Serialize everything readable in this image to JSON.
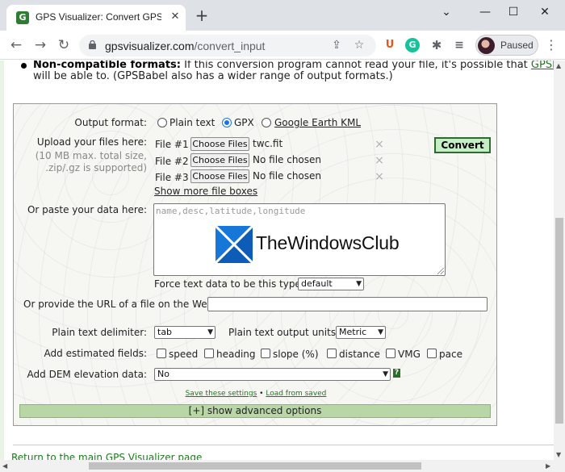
{
  "browser": {
    "tab_title": "GPS Visualizer: Convert GPS files",
    "url_host": "gpsvisualizer.com",
    "url_path": "/convert_input",
    "profile_status": "Paused"
  },
  "page": {
    "note_bold": "Non-compatible formats:",
    "note_text": "If this conversion program cannot read your file, it's possible that",
    "note_link": "GPSBabel",
    "note_line2": "will be able to. (GPSBabel also has a wider range of output formats.)",
    "form": {
      "output_format_label": "Output format:",
      "output_options": [
        "Plain text",
        "GPX",
        "Google Earth KML"
      ],
      "output_selected": "GPX",
      "upload_label": "Upload your files here:",
      "upload_sub1": "(10 MB max. total size,",
      "upload_sub2": ".zip/.gz is supported)",
      "files": [
        {
          "label": "File #1",
          "button": "Choose Files",
          "status": "twc.fit"
        },
        {
          "label": "File #2",
          "button": "Choose Files",
          "status": "No file chosen"
        },
        {
          "label": "File #3",
          "button": "Choose Files",
          "status": "No file chosen"
        }
      ],
      "show_more": "Show more file boxes",
      "convert_button": "Convert",
      "paste_label": "Or paste your data here:",
      "paste_placeholder": "name,desc,latitude,longitude",
      "watermark": "TheWindowsClub",
      "force_label": "Force text data to be this type:",
      "force_value": "default",
      "url_label": "Or provide the URL of a file on the Web:",
      "delimiter_label": "Plain text delimiter:",
      "delimiter_value": "tab",
      "units_label": "Plain text output units:",
      "units_value": "Metric",
      "estimated_label": "Add estimated fields:",
      "estimated_fields": [
        "speed",
        "heading",
        "slope (%)",
        "distance",
        "VMG",
        "pace"
      ],
      "dem_label": "Add DEM elevation data:",
      "dem_value": "No",
      "help_mark": "?",
      "save_settings": "Save these settings",
      "links_separator": "•",
      "load_saved": "Load from saved",
      "advanced": "[+] show advanced options"
    },
    "return_link": "Return to the main GPS Visualizer page"
  },
  "colors": {
    "link": "#1a7a1a",
    "convert_bg": "#c6eec6",
    "advanced_bg": "#b9d6a6",
    "accent": "#1a73e8"
  }
}
